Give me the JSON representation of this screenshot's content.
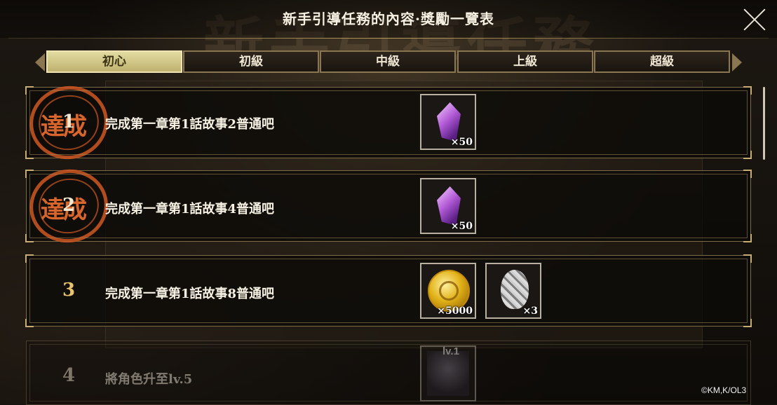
{
  "header": {
    "title": "新手引導任務的內容·獎勵一覽表",
    "background_watermark": "新手引導任務"
  },
  "tabs": [
    {
      "label": "初心",
      "active": true
    },
    {
      "label": "初級",
      "active": false
    },
    {
      "label": "中級",
      "active": false
    },
    {
      "label": "上級",
      "active": false
    },
    {
      "label": "超級",
      "active": false
    }
  ],
  "tasks": [
    {
      "number": "1",
      "description": "完成第一章第1話故事2普通吧",
      "completed": true,
      "stamp_text": "達成",
      "rewards": [
        {
          "icon": "crystal-icon",
          "quantity": "×50"
        }
      ]
    },
    {
      "number": "2",
      "description": "完成第一章第1話故事4普通吧",
      "completed": true,
      "stamp_text": "達成",
      "rewards": [
        {
          "icon": "crystal-icon",
          "quantity": "×50"
        }
      ]
    },
    {
      "number": "3",
      "description": "完成第一章第1話故事8普通吧",
      "completed": false,
      "rewards": [
        {
          "icon": "gold-coin-icon",
          "quantity": "×5000"
        },
        {
          "icon": "silver-egg-icon",
          "quantity": "×3"
        }
      ]
    },
    {
      "number": "4",
      "description": "將角色升至lv.5",
      "completed": false,
      "rewards": [
        {
          "icon": "character-portrait-icon",
          "level": "lv.1"
        }
      ]
    }
  ],
  "footer": {
    "copyright": "©KM,K/OL3"
  },
  "colors": {
    "accent_gold": "#c7ad73",
    "stamp_orange": "#d8652c",
    "active_tab": "#e2dba0"
  }
}
